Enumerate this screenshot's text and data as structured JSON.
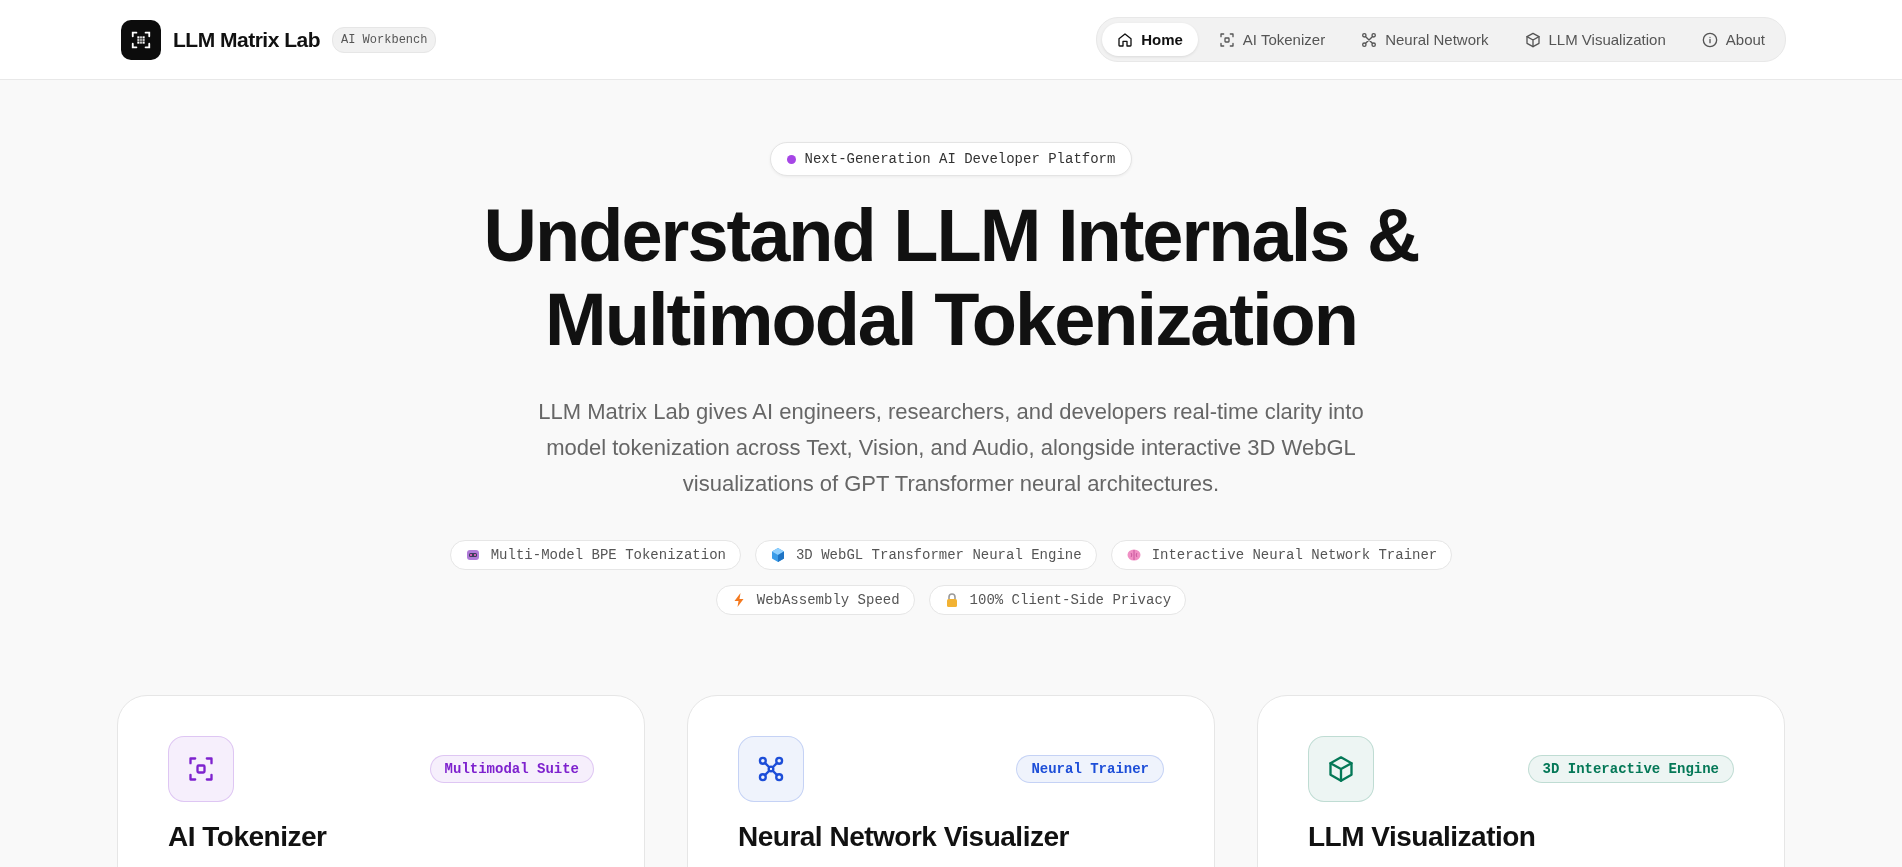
{
  "header": {
    "brand": "LLM Matrix Lab",
    "tag": "AI Workbench"
  },
  "nav": [
    {
      "label": "Home",
      "kind": "home",
      "selected": true
    },
    {
      "label": "AI Tokenizer",
      "kind": "scan",
      "selected": false
    },
    {
      "label": "Neural Network",
      "kind": "network",
      "selected": false
    },
    {
      "label": "LLM Visualization",
      "kind": "cube",
      "selected": false
    },
    {
      "label": "About",
      "kind": "info",
      "selected": false
    }
  ],
  "hero": {
    "badge": "Next-Generation AI Developer Platform",
    "title_lines": [
      "Understand LLM Internals &",
      "Multimodal Tokenization"
    ],
    "description": "LLM Matrix Lab gives AI engineers, researchers, and developers real-time clarity into model tokenization across Text, Vision, and Audio, alongside interactive 3D WebGL visualizations of GPT Transformer neural architectures."
  },
  "feature_rows": [
    [
      {
        "label": "Multi-Model BPE Tokenization",
        "kind": "robot"
      },
      {
        "label": "3D WebGL Transformer Neural Engine",
        "kind": "cube"
      },
      {
        "label": "Interactive Neural Network Trainer",
        "kind": "brain"
      }
    ],
    [
      {
        "label": "WebAssembly Speed",
        "kind": "bolt"
      },
      {
        "label": "100% Client-Side Privacy",
        "kind": "lock"
      }
    ]
  ],
  "cards": [
    {
      "title": "AI Tokenizer",
      "tag": "Multimodal Suite",
      "kind": "scan",
      "color": "#7e22ce"
    },
    {
      "title": "Neural Network Visualizer",
      "tag": "Neural Trainer",
      "kind": "network",
      "color": "#1d4ed8"
    },
    {
      "title": "LLM Visualization",
      "tag": "3D Interactive Engine",
      "kind": "cube",
      "color": "#047857"
    }
  ]
}
